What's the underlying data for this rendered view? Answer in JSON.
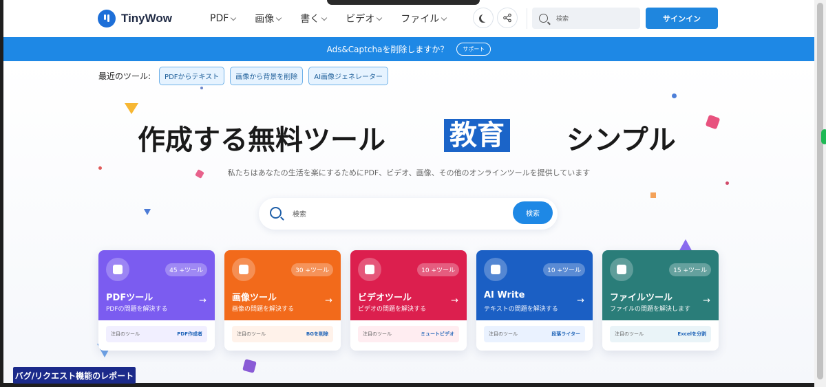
{
  "header": {
    "brand": "TinyWow",
    "nav": [
      {
        "label": "PDF"
      },
      {
        "label": "画像"
      },
      {
        "label": "書く"
      },
      {
        "label": "ビデオ"
      },
      {
        "label": "ファイル"
      }
    ],
    "search_placeholder": "検索",
    "signin_label": "サインイン"
  },
  "banner": {
    "text": "Ads&Captchaを削除しますか？",
    "button": "サポート"
  },
  "recent": {
    "label": "最近のツール:",
    "chips": [
      "PDFからテキスト",
      "画像から背景を削除",
      "AI画像ジェネレーター"
    ]
  },
  "hero": {
    "title_part1": "作成する無料ツール",
    "title_highlight": "教育",
    "title_part3": "シンプル",
    "subtitle": "私たちはあなたの生活を楽にするためにPDF、ビデオ、画像、その他のオンラインツールを提供しています",
    "search_placeholder": "検索",
    "search_button": "検索"
  },
  "cards": [
    {
      "title": "PDFツール",
      "desc": "PDFの問題を解決する",
      "badge": "45 +ツール",
      "foot_label": "注目のツール",
      "foot_tool": "PDF作成者",
      "color": "#7b5cf0",
      "foot_bg": "#f1efff"
    },
    {
      "title": "画像ツール",
      "desc": "画像の問題を解決する",
      "badge": "30 +ツール",
      "foot_label": "注目のツール",
      "foot_tool": "BGを削除",
      "color": "#f26a1b",
      "foot_bg": "#fff2ea"
    },
    {
      "title": "ビデオツール",
      "desc": "ビデオの問題を解決する",
      "badge": "10 +ツール",
      "foot_label": "注目のツール",
      "foot_tool": "ミュートビデオ",
      "color": "#dc1f4e",
      "foot_bg": "#ffedf1"
    },
    {
      "title": "AI Write",
      "desc": "テキストの問題を解決する",
      "badge": "10 +ツール",
      "foot_label": "注目のツール",
      "foot_tool": "段落ライター",
      "color": "#1b5fc4",
      "foot_bg": "#eaf2ff"
    },
    {
      "title": "ファイルツール",
      "desc": "ファイルの問題を解決します",
      "badge": "15 +ツール",
      "foot_label": "注目のツール",
      "foot_tool": "Excelを分割",
      "color": "#2a7d79",
      "foot_bg": "#eaf4f8"
    }
  ],
  "report_button": "バグ/リクエスト機能のレポート",
  "icons": {
    "theme": "moon-icon",
    "share": "share-icon",
    "search": "search-icon",
    "arrow": "arrow-right-icon"
  }
}
